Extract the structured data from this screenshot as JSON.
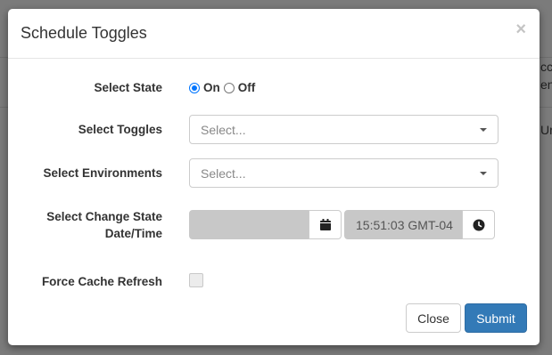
{
  "background": {
    "text_1": "cc",
    "text_2": "en",
    "text_3": "Ur"
  },
  "modal": {
    "title": "Schedule Toggles",
    "close_icon": "×"
  },
  "form": {
    "state": {
      "label": "Select State",
      "options": [
        {
          "label": "On",
          "checked": true
        },
        {
          "label": "Off",
          "checked": false
        }
      ]
    },
    "toggles": {
      "label": "Select Toggles",
      "placeholder": "Select..."
    },
    "environments": {
      "label": "Select Environments",
      "placeholder": "Select..."
    },
    "change_state": {
      "label_line1": "Select Change State",
      "label_line2": "Date/Time",
      "date_value": "",
      "time_value": "15:51:03 GMT-04"
    },
    "cache": {
      "label": "Force Cache Refresh",
      "checked": false
    }
  },
  "footer": {
    "close_label": "Close",
    "submit_label": "Submit"
  },
  "colors": {
    "primary": "#337ab7",
    "radio_accent": "#0075ff",
    "disabled_input": "#c8c8c8"
  },
  "icons": {
    "date": "calendar-icon",
    "time": "clock-icon"
  }
}
